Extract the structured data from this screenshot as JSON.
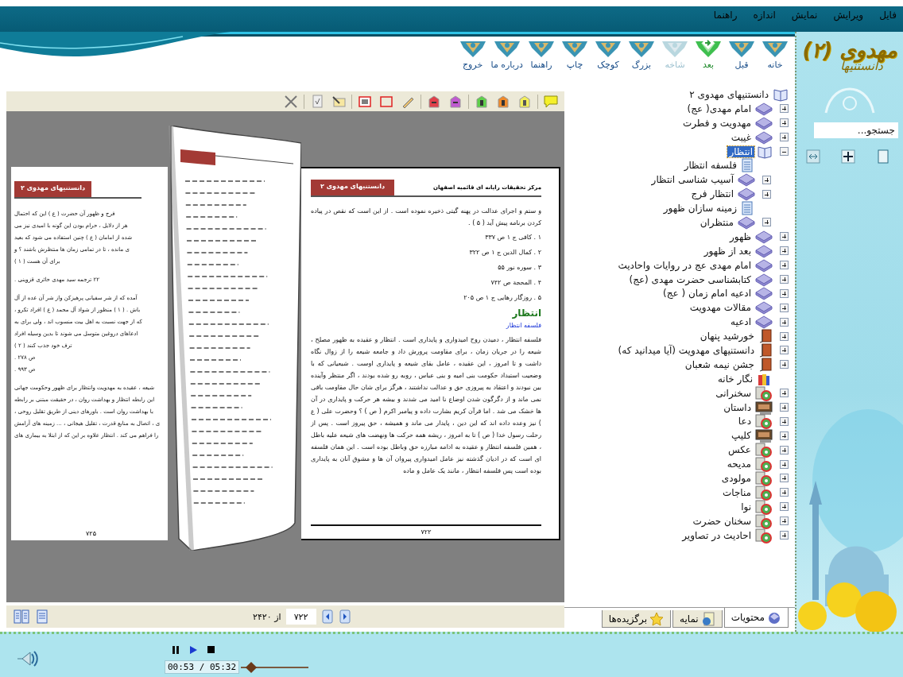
{
  "menu": [
    {
      "label": "فایل"
    },
    {
      "label": "ویرایش"
    },
    {
      "label": "نمایش"
    },
    {
      "label": "اندازه"
    },
    {
      "label": "راهنما"
    }
  ],
  "nav_buttons": [
    {
      "label": "خانه",
      "selected": false,
      "disabled": false
    },
    {
      "label": "قبل",
      "selected": false,
      "disabled": false
    },
    {
      "label": "بعد",
      "selected": true,
      "disabled": false
    },
    {
      "label": "شاخه",
      "selected": false,
      "disabled": true
    },
    {
      "label": "بزرگ",
      "selected": false,
      "disabled": false
    },
    {
      "label": "کوچک",
      "selected": false,
      "disabled": false
    },
    {
      "label": "چاپ",
      "selected": false,
      "disabled": false
    },
    {
      "label": "راهنما",
      "selected": false,
      "disabled": false
    },
    {
      "label": "درباره ما",
      "selected": false,
      "disabled": false
    },
    {
      "label": "خروج",
      "selected": false,
      "disabled": false
    }
  ],
  "logo": {
    "title": "مهدوی",
    "number": "(۲)",
    "subtitle": "دانستنیها"
  },
  "search": {
    "placeholder": "جستجو..."
  },
  "viewer": {
    "left_page": {
      "header": "دانستنیهای مهدوی ۲",
      "lines": [
        "فرج و ظهور آن حضرت ( ع ) این که احتمال",
        "هر از دلایل ، حرام بودن این گونه با امیدی نیز می",
        "شده از امامان ( ع ) چنین استفاده می شود که بعید",
        "ی مانده ، تا در تمامی زمان ها منتظرش باشند ؟ و",
        "برای آن هست ( ۱ )",
        "۲۲ ترجمه سید مهدی حائری قزوینی .",
        "آمده که از شر سفیانی پرهیزکن واز شر آن عده از آل",
        "باش . ( ۱ ) منظور از شواذ آل محمد ( ع ) افراد تکرو ،",
        "که از جهت نسبت به اهل بیت منسوب اند ، ولی برای به",
        "ادعاهای دروغین متوسل می شوند تا بدین وسیله افراد",
        "ترف خود جذب کنند ( ۲ )",
        "ص ۲۷۸ .",
        "ص ۹۹۳ .",
        "شیعه ، عقیده به مهدویت وانتظار برای ظهور وحکومت جهانی",
        "این رابطه انتظار و بهداشت روان ، در حقیقت مبتنی بر رابطه",
        "با بهداشت روان است . باورهای دینی از طریق تقلیل روحی ،",
        "ی ، اتصال به منابع قدرت ، تقلیل هیجانی ، ... زمینه های آرامش",
        "را فراهم می کند . انتظار علاوه بر این که از ابتلا به بیماری های"
      ],
      "page_number": "۷۲۵"
    },
    "right_page": {
      "header": "دانستنیهای مهدوی ۲",
      "source": "مرکز تحقیقات رایانه ای قائمیه اصفهان",
      "intro": "و ستم و اجرای عدالت در پهنه گیتی ذخیره نموده است . از این است که نقص در پیاده کردن برنامه پیش آید ( ۵ ) .",
      "references": [
        "۱ . کافی ج ۱ ص ۳۳۷",
        "۲ . کمال الدین ج ۱ ص ۳۲۲",
        "۳ . سوره نور ۵۵",
        "۴ . المحجة ص ۷۴۲",
        "۵ . روزگار رهایی ج ۱ ص ۲۰۵"
      ],
      "heading": "انتظار",
      "subheading": "فلسفه انتظار",
      "body": "فلسفه انتظار ، دمیدن روح امیدواری و پایداری است . انتظار و عقیده به ظهور مصلح ، شیعه را در جریان زمان ، برای مقاومت پرورش داد و جامعه شیعه را از زوال نگاه داشت و تا امروز ، این عقیده ، عامل بقای شیعه و پایداری اوست . شیعیانی که با وضعیت استبداد حکومت بنی امیه و بنی عباس ، روبه رو شده بودند ، اگر منتظر وآینده بین نبودند و اعتقاد به پیروزی حق و عدالت نداشتند ، هرگز برای شان حال مقاومت باقی نمی ماند و از دگرگون شدن اوضاع نا امید می شدند و بیشه هر حرکت و پایداری در آن ها خشک می شد . اما قرآن کریم بشارت داده و پیامبر اکرم ( ص ) ؟ وحضرت علی ( ع ) نیز وعده داده اند که این دین ، پایدار می ماند و همیشه ، حق پیروز است . پس از رحلت رسول خدا ( ص ) تا به امروز ، ریشه همه حرکت ها ونهضت های شیعه علیه باطل ، همین فلسفه انتظار و عقیده به ادامه مبارزه حق وباطل بوده است . این همان فلسفه ای است که در ادیان گذشته نیز عامل امیدواری پیروان آن ها و مشوق آنان به پایداری بوده است پس فلسفه انتظار ، مانند یک عامل و ماده",
      "page_number": "۷۲۲"
    },
    "page_input": "۷۲۲",
    "page_total": "از ۲۴۲۰"
  },
  "tree": {
    "label": "دانستنیهای مهدوی ۲",
    "kind": "open-book",
    "selected": false,
    "children": [
      {
        "label": "امام مهدی( عج)",
        "kind": "book",
        "selected": false,
        "expanded": false
      },
      {
        "label": "مهدویت و فطرت",
        "kind": "book",
        "selected": false,
        "expanded": false
      },
      {
        "label": "غیبت",
        "kind": "book",
        "selected": false,
        "expanded": false
      },
      {
        "label": "انتظار",
        "kind": "open-book",
        "selected": true,
        "expanded": true,
        "children": [
          {
            "label": "فلسفه انتظار",
            "kind": "document",
            "selected": false
          },
          {
            "label": "آسیب شناسی انتظار",
            "kind": "book",
            "selected": false,
            "expanded": false
          },
          {
            "label": "انتظار فرج",
            "kind": "book",
            "selected": false,
            "expanded": false
          },
          {
            "label": "زمینه سازان ظهور",
            "kind": "document",
            "selected": false
          },
          {
            "label": "منتظران",
            "kind": "book",
            "selected": false,
            "expanded": false
          }
        ]
      },
      {
        "label": "ظهور",
        "kind": "book",
        "selected": false,
        "expanded": false
      },
      {
        "label": "بعد از ظهور",
        "kind": "book",
        "selected": false,
        "expanded": false
      },
      {
        "label": "امام مهدی عج در روایات واحادیث",
        "kind": "book",
        "selected": false,
        "expanded": false
      },
      {
        "label": "کتابشناسی حضرت مهدی (عج)",
        "kind": "book",
        "selected": false,
        "expanded": false
      },
      {
        "label": "ادعیه امام زمان ( عج)",
        "kind": "book",
        "selected": false,
        "expanded": false
      },
      {
        "label": "مقالات مهدویت",
        "kind": "book",
        "selected": false,
        "expanded": false
      },
      {
        "label": "ادعیه",
        "kind": "book",
        "selected": false,
        "expanded": false
      },
      {
        "label": "خورشید پنهان",
        "kind": "brown-book",
        "selected": false,
        "expanded": false
      },
      {
        "label": "دانستنیهای مهدویت (آیا میدانید که)",
        "kind": "brown-book",
        "selected": false,
        "expanded": false
      },
      {
        "label": "جشن نیمه شعبان",
        "kind": "brown-book",
        "selected": false,
        "expanded": false
      },
      {
        "label": "نگار خانه",
        "kind": "paint",
        "selected": false
      },
      {
        "label": "سخنرانی",
        "kind": "media",
        "selected": false,
        "expanded": false
      },
      {
        "label": "داستان",
        "kind": "film",
        "selected": false,
        "expanded": false
      },
      {
        "label": "دعا",
        "kind": "media",
        "selected": false,
        "expanded": false
      },
      {
        "label": "کلیپ",
        "kind": "film",
        "selected": false,
        "expanded": false
      },
      {
        "label": "عکس",
        "kind": "media",
        "selected": false,
        "expanded": false
      },
      {
        "label": "مدیحه",
        "kind": "media",
        "selected": false,
        "expanded": false
      },
      {
        "label": "مولودی",
        "kind": "media",
        "selected": false,
        "expanded": false
      },
      {
        "label": "مناجات",
        "kind": "media",
        "selected": false,
        "expanded": false
      },
      {
        "label": "نوا",
        "kind": "media",
        "selected": false,
        "expanded": false
      },
      {
        "label": "سخنان حضرت",
        "kind": "media",
        "selected": false,
        "expanded": false
      },
      {
        "label": "احادیث در تصاویر",
        "kind": "media",
        "selected": false,
        "expanded": false
      }
    ]
  },
  "tabs": [
    {
      "label": "محتویات",
      "kind": "contents",
      "selected": true
    },
    {
      "label": "نمایه",
      "kind": "index",
      "selected": false
    },
    {
      "label": "برگزیده‌ها",
      "kind": "favorites",
      "selected": false
    }
  ],
  "player": {
    "time": "00:53 / 05:32",
    "level": 0.15
  }
}
